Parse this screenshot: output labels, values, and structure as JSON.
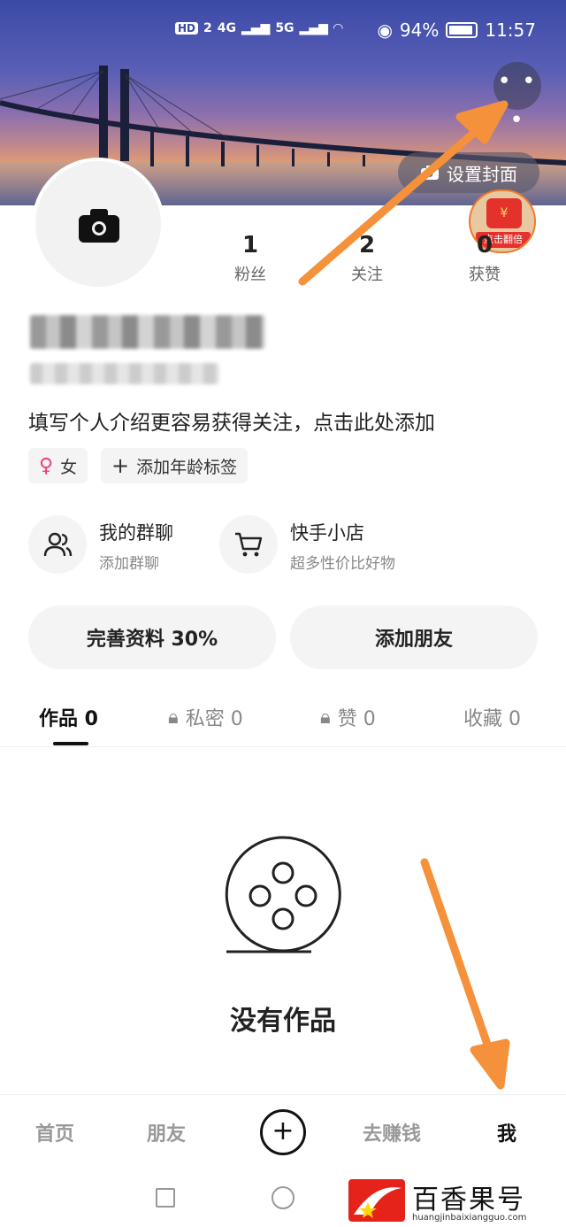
{
  "status_bar": {
    "network_left": "HD",
    "network_left_sub": "2",
    "signal_4g": "4G",
    "signal_5g": "5G",
    "battery": "94%",
    "time": "11:57"
  },
  "header": {
    "more_label": "• • •",
    "set_cover_label": "设置封面"
  },
  "red_packet": {
    "label": "点击翻倍",
    "symbol": "¥"
  },
  "stats": [
    {
      "value": "1",
      "label": "粉丝"
    },
    {
      "value": "2",
      "label": "关注"
    },
    {
      "value": "0",
      "label": "获赞"
    }
  ],
  "profile": {
    "intro": "填写个人介绍更容易获得关注，点击此处添加",
    "gender_tag": "女",
    "age_tag": "添加年龄标签"
  },
  "features": [
    {
      "title": "我的群聊",
      "subtitle": "添加群聊"
    },
    {
      "title": "快手小店",
      "subtitle": "超多性价比好物"
    }
  ],
  "actions": {
    "complete_profile": "完善资料 30%",
    "add_friend": "添加朋友"
  },
  "tabs": [
    {
      "label": "作品 0"
    },
    {
      "label": "私密 0"
    },
    {
      "label": "赞 0"
    },
    {
      "label": "收藏 0"
    }
  ],
  "empty_state": {
    "text": "没有作品"
  },
  "bottom_nav": {
    "home": "首页",
    "friends": "朋友",
    "plus": "+",
    "earn": "去赚钱",
    "me": "我"
  },
  "watermark": {
    "title": "百香果号",
    "url": "huangjinbaixiangguo.com"
  },
  "colors": {
    "accent_orange": "#f5913a",
    "female": "#ee3d7a",
    "red": "#e5231b"
  }
}
